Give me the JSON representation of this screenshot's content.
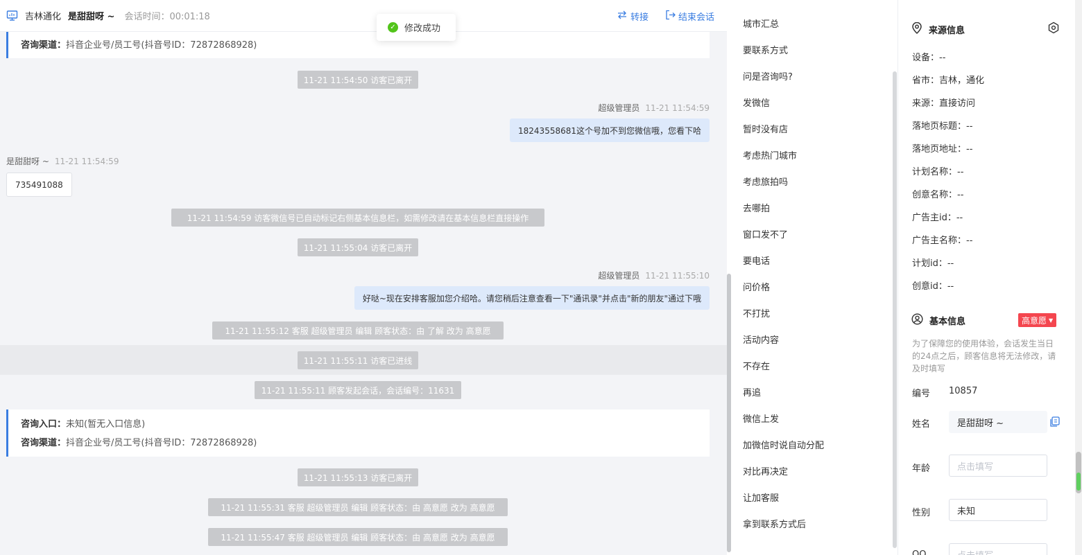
{
  "header": {
    "location": "吉林通化",
    "visitor_name": "是甜甜呀 ~",
    "session_time": "会话时间：00:01:18",
    "transfer_label": "转接",
    "end_label": "结束会话"
  },
  "toast": {
    "text": "修改成功"
  },
  "chat": {
    "channel_top": {
      "label": "咨询渠道：",
      "value": "抖音企业号/员工号(抖音号ID：72872868928)"
    },
    "sys_1": "11-21 11:54:50 访客已离开",
    "msg_1": {
      "sender": "超级管理员",
      "time": "11-21 11:54:59",
      "text": "18243558681这个号加不到您微信哦，您看下哈"
    },
    "msg_2": {
      "sender": "是甜甜呀 ~",
      "time": "11-21 11:54:59",
      "text": "735491088"
    },
    "sys_2": "11-21 11:54:59 访客微信号已自动标记右侧基本信息栏，如需修改请在基本信息栏直接操作",
    "sys_3": "11-21 11:55:04 访客已离开",
    "msg_3": {
      "sender": "超级管理员",
      "time": "11-21 11:55:10",
      "text": "好哒~现在安排客服加您介绍哈。请您稍后注意查看一下\"通讯录\"并点击\"新的朋友\"通过下哦"
    },
    "sys_4": "11-21 11:55:12 客服 超级管理员 编辑 顾客状态：由 了解 改为 高意愿",
    "sys_5": "11-21 11:55:11 访客已进线",
    "sys_6": "11-21 11:55:11 顾客发起会话，会话编号：11631",
    "entry": {
      "label": "咨询入口：",
      "value": "未知(暂无入口信息)"
    },
    "channel_bottom": {
      "label": "咨询渠道：",
      "value": "抖音企业号/员工号(抖音号ID：72872868928)"
    },
    "sys_7": "11-21 11:55:13 访客已离开",
    "sys_8": "11-21 11:55:31 客服 超级管理员 编辑 顾客状态：由 高意愿 改为 高意愿",
    "sys_9": "11-21 11:55:47 客服 超级管理员 编辑 顾客状态：由 高意愿 改为 高意愿"
  },
  "quick_replies": [
    "城市汇总",
    "要联系方式",
    "问是咨询吗?",
    "发微信",
    "暂时没有店",
    "考虑热门城市",
    "考虑旅拍吗",
    "去哪拍",
    "窗口发不了",
    "要电话",
    "问价格",
    "不打扰",
    "活动内容",
    "不存在",
    "再追",
    "微信上发",
    "加微信时说自动分配",
    "对比再决定",
    "让加客服",
    "拿到联系方式后"
  ],
  "source_info": {
    "title": "来源信息",
    "rows": [
      "设备：--",
      "省市：吉林，通化",
      "来源：直接访问",
      "落地页标题：--",
      "落地页地址：--",
      "计划名称：--",
      "创意名称：--",
      "广告主id：--",
      "广告主名称：--",
      "计划id：--",
      "创意id：--"
    ]
  },
  "basic_info": {
    "title": "基本信息",
    "intent_badge": "高意愿",
    "note": "为了保障您的使用体验，会话发生当日的24点之后，顾客信息将无法修改，请及时填写",
    "id_label": "编号",
    "id_value": "10857",
    "name_label": "姓名",
    "name_value": "是甜甜呀 ~",
    "age_label": "年龄",
    "age_placeholder": "点击填写",
    "gender_label": "性别",
    "gender_value": "未知",
    "qq_label": "QQ",
    "qq_placeholder": "点击填写"
  },
  "colors": {
    "accent": "#3a7de1",
    "badge": "#f4464f",
    "success": "#52c41a",
    "system_pill": "#c8c9cc",
    "agent_bubble": "#dde9fb"
  }
}
